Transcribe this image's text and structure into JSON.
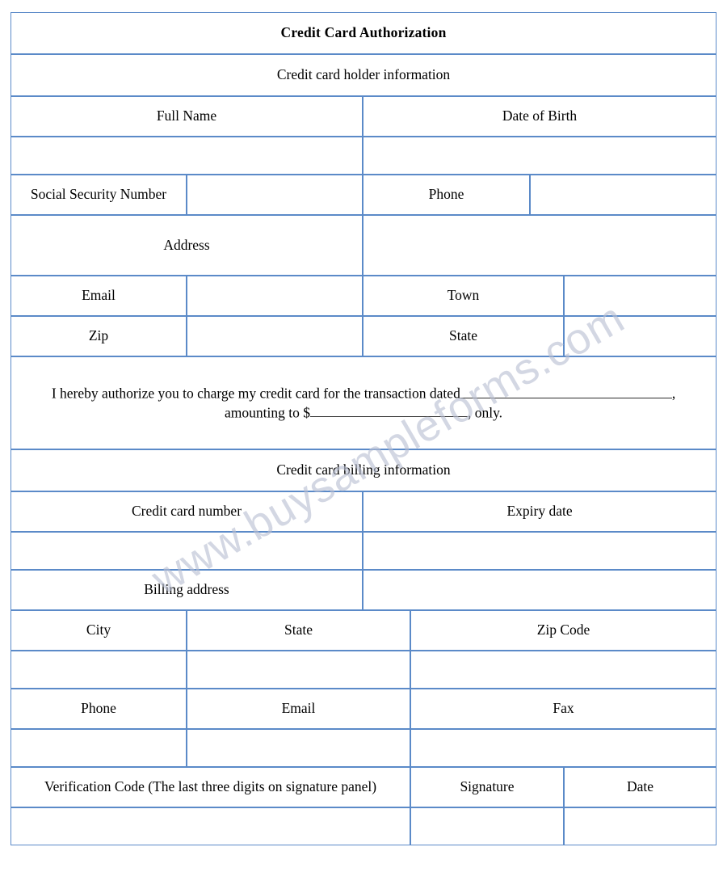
{
  "document": {
    "title": "Credit Card Authorization",
    "watermark": "www.buysampleforms.com"
  },
  "sections": {
    "holder": {
      "heading": "Credit card holder information",
      "labels": {
        "full_name": "Full Name",
        "date_of_birth": "Date of Birth",
        "social_security_number": "Social Security Number",
        "phone": "Phone",
        "address": "Address",
        "email": "Email",
        "town": "Town",
        "zip": "Zip",
        "state": "State"
      },
      "values": {
        "full_name": "",
        "date_of_birth": "",
        "social_security_number": "",
        "phone": "",
        "address": "",
        "email": "",
        "town": "",
        "zip": "",
        "state": ""
      }
    },
    "authorization": {
      "line1_before": "I hereby authorize you to charge my credit card for the transaction dated",
      "line1_after": ",",
      "line2_before": "amounting  to $",
      "line2_after": ", only."
    },
    "billing": {
      "heading": "Credit card billing information",
      "labels": {
        "credit_card_number": "Credit card number",
        "expiry_date": "Expiry date",
        "billing_address": "Billing address",
        "city": "City",
        "state": "State",
        "zip_code": "Zip Code",
        "phone": "Phone",
        "email": "Email",
        "fax": "Fax",
        "verification_code": "Verification Code (The last three digits on signature panel)",
        "signature": "Signature",
        "date": "Date"
      },
      "values": {
        "credit_card_number": "",
        "expiry_date": "",
        "billing_address": "",
        "city": "",
        "state": "",
        "zip_code": "",
        "phone": "",
        "email": "",
        "fax": "",
        "verification_code": "",
        "signature": "",
        "date": ""
      }
    }
  },
  "colors": {
    "border": "#5b8ac8",
    "shaded_row": "#dbe5f1",
    "page_background": "#ffffff",
    "text": "#000000",
    "watermark": "#b9bfd2"
  }
}
